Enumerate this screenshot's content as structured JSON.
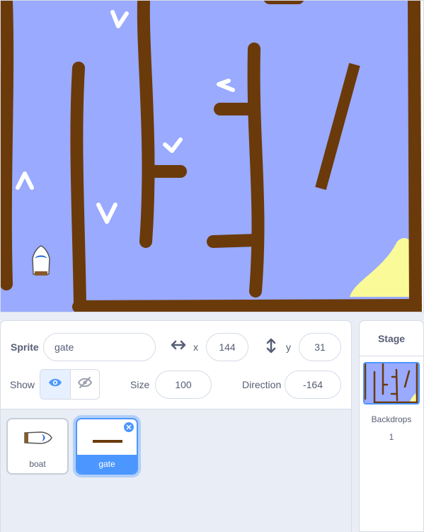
{
  "sprite_info": {
    "sprite_label": "Sprite",
    "sprite_name": "gate",
    "x_label": "x",
    "x_value": "144",
    "y_label": "y",
    "y_value": "31",
    "show_label": "Show",
    "size_label": "Size",
    "size_value": "100",
    "direction_label": "Direction",
    "direction_value": "-164",
    "visible": true
  },
  "sprites": [
    {
      "name": "boat",
      "selected": false
    },
    {
      "name": "gate",
      "selected": true
    }
  ],
  "stage_pane": {
    "title": "Stage",
    "backdrops_label": "Backdrops",
    "backdrops_count": "1"
  },
  "colors": {
    "water": "#99aaff",
    "wall": "#6b3a0a",
    "sand": "#fafa99",
    "accent": "#4c97ff"
  },
  "icons": {
    "visible": "eye-icon",
    "hidden": "eye-slash-icon",
    "x_axis": "horizontal-arrows-icon",
    "y_axis": "vertical-arrows-icon",
    "delete": "close-icon"
  }
}
